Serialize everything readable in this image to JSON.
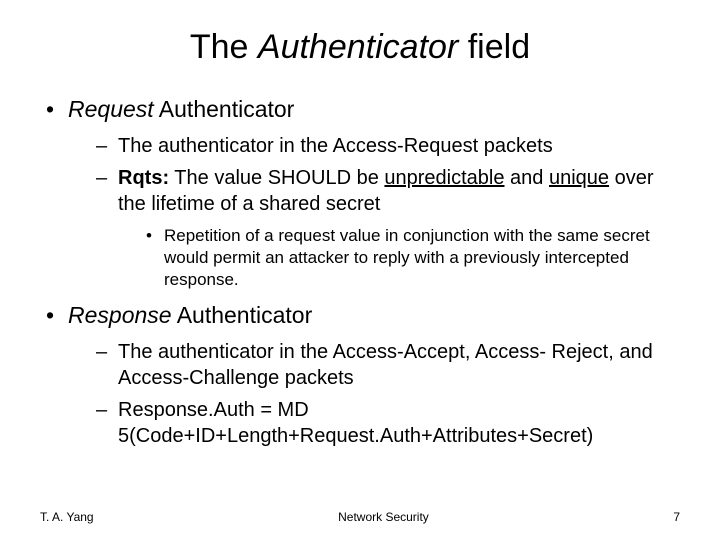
{
  "title": {
    "prefix": "The ",
    "italic": "Authenticator",
    "suffix": " field"
  },
  "bullets": [
    {
      "italic": "Request",
      "rest": " Authenticator",
      "children": [
        {
          "text": "The authenticator in the Access-Request packets"
        },
        {
          "bold_prefix": "Rqts:",
          "mid1": " The value SHOULD be ",
          "u1": "unpredictable",
          "mid2": " and ",
          "u2": "unique",
          "tail": " over the lifetime of a shared secret",
          "children": [
            {
              "text": "Repetition of a request value in conjunction with the same secret would permit an attacker to reply with a previously intercepted response."
            }
          ]
        }
      ]
    },
    {
      "italic": "Response",
      "rest": " Authenticator",
      "children": [
        {
          "text": "The authenticator in the Access-Accept, Access- Reject, and Access-Challenge packets"
        },
        {
          "text": "Response.Auth = MD 5(Code+ID+Length+Request.Auth+Attributes+Secret)"
        }
      ]
    }
  ],
  "footer": {
    "left": "T. A. Yang",
    "center": "Network Security",
    "right": "7"
  }
}
